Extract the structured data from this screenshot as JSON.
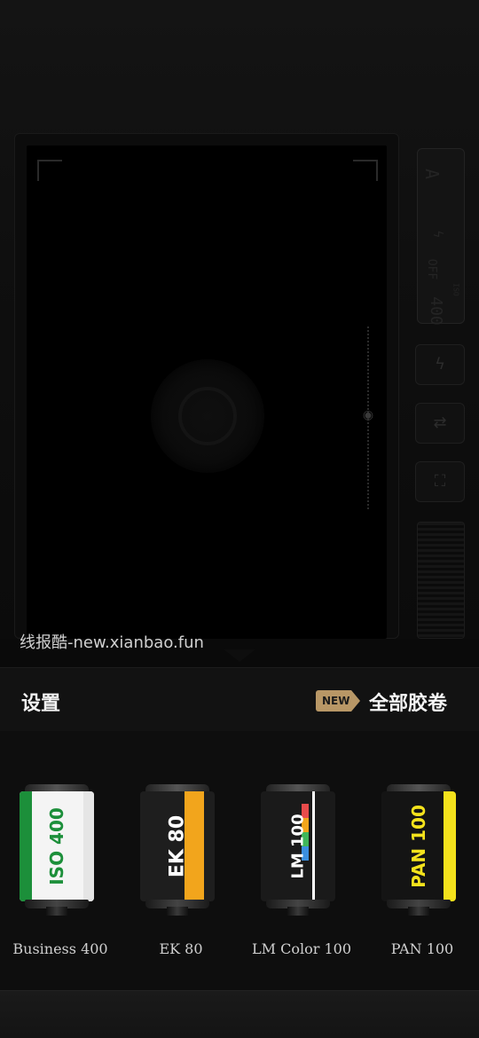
{
  "camera": {
    "lcd": {
      "mode": "A",
      "flash_mark": "ϟ",
      "flash_state": "OFF",
      "iso_value": "400",
      "iso_label": "ISO"
    },
    "buttons": {
      "flash_icon": "flash-icon",
      "flip_icon": "flip-camera-icon",
      "frame_icon": "frame-icon"
    }
  },
  "watermark": "线报酷-new.xianbao.fun",
  "sheet": {
    "settings_label": "设置",
    "new_badge": "NEW",
    "all_films_label": "全部胶卷"
  },
  "films": [
    {
      "name": "Business 400",
      "can_text": "ISO 400",
      "can_color": "#ffffff",
      "accent": "#1c8f3a",
      "text_color": "#1c8f3a"
    },
    {
      "name": "EK 80",
      "can_text": "EK 80",
      "can_color": "#1e1e1e",
      "accent": "#f2a51c",
      "text_color": "#ffffff"
    },
    {
      "name": "LM Color 100",
      "can_text": "LM 100",
      "can_color": "#1a1a1a",
      "accent": "#e84b4b",
      "text_color": "#ffffff"
    },
    {
      "name": "PAN 100",
      "can_text": "PAN 100",
      "can_color": "#141414",
      "accent": "#f4e21c",
      "text_color": "#f4e21c"
    }
  ],
  "colors": {
    "badge": "#b89766",
    "background": "#0a0a0a"
  }
}
